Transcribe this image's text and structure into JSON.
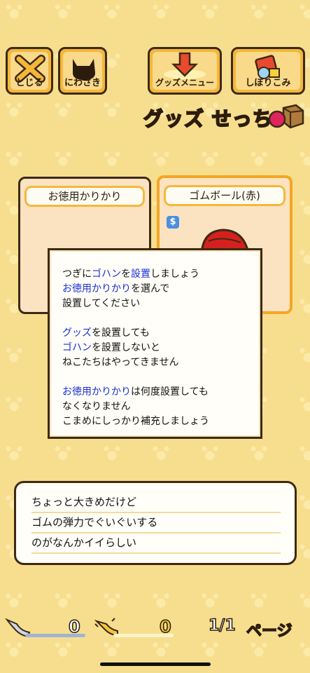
{
  "toolbar": {
    "close_label": "とじる",
    "yard_label": "にわさき",
    "goods_menu_label": "グッズメニュー",
    "filter_label": "しぼりこみ"
  },
  "header": {
    "title": "グッズ せっち"
  },
  "cards": [
    {
      "name": "お徳用かりかり"
    },
    {
      "name": "ゴムボール(赤)",
      "badge": "$"
    }
  ],
  "dialog": {
    "p1": [
      {
        "t": "つぎに",
        "h": false
      },
      {
        "t": "ゴハン",
        "h": true
      },
      {
        "t": "を",
        "h": false
      },
      {
        "t": "設置",
        "h": true
      },
      {
        "t": "しましょう\n",
        "h": false
      },
      {
        "t": "お徳用かりかり",
        "h": true
      },
      {
        "t": "を選んで\n設置してください",
        "h": false
      }
    ],
    "p2": [
      {
        "t": "グッズ",
        "h": true
      },
      {
        "t": "を設置しても\n",
        "h": false
      },
      {
        "t": "ゴハン",
        "h": true
      },
      {
        "t": "を設置しないと\nねこたちはやってきません",
        "h": false
      }
    ],
    "p3": [
      {
        "t": "お徳用かりかり",
        "h": true
      },
      {
        "t": "は何度設置しても\nなくなりません\nこまめにしっかり補充しましょう",
        "h": false
      }
    ]
  },
  "description": {
    "lines": [
      "ちょっと大きめだけど",
      "ゴムの弾力でぐいぐいする",
      "のがなんかイイらしい"
    ]
  },
  "footer": {
    "silver_fish": "0",
    "gold_fish": "0",
    "page": "1/1",
    "page_label": "ページ"
  },
  "colors": {
    "background": "#f7de8e",
    "button_orange": "#f5b73a",
    "highlight_text": "#1a2fd6",
    "outline": "#3c2a14"
  },
  "icons": [
    "close-x-icon",
    "cat-silhouette-icon",
    "down-arrow-icon",
    "gift-box-icon",
    "ball-and-box-icon",
    "dollar-badge-icon",
    "silver-fish-icon",
    "gold-fish-icon"
  ]
}
